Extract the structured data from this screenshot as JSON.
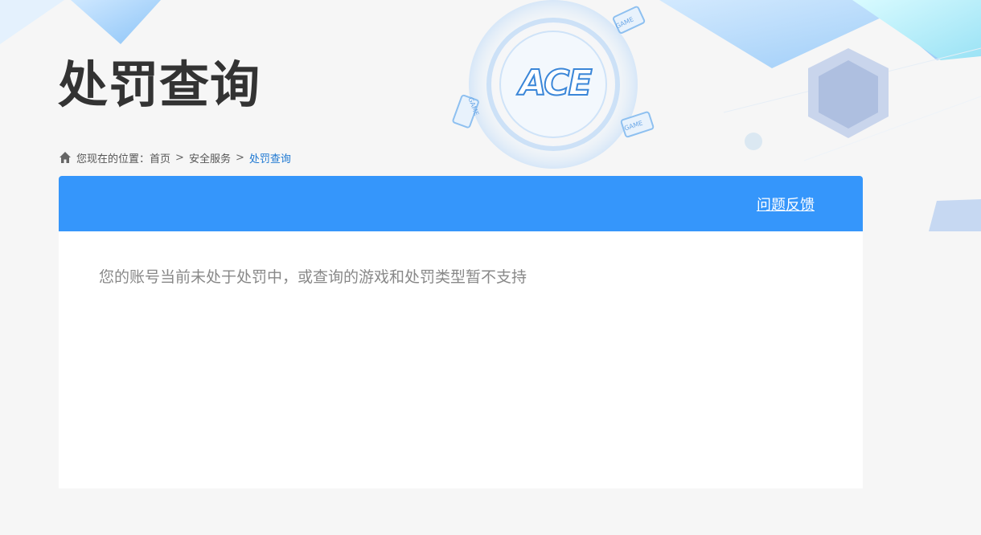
{
  "page": {
    "title": "处罚查询"
  },
  "logo": {
    "text": "ACE",
    "badges": [
      "GAME",
      "GAME",
      "GAME"
    ]
  },
  "breadcrumb": {
    "prefix": "您现在的位置：",
    "items": [
      "首页",
      "安全服务",
      "处罚查询"
    ],
    "separator": ">"
  },
  "panel": {
    "feedback_label": "问题反馈",
    "message": "您的账号当前未处于处罚中，或查询的游戏和处罚类型暂不支持"
  },
  "colors": {
    "accent": "#3596fb",
    "breadcrumb_current": "#1e78d2",
    "title": "#333333"
  }
}
